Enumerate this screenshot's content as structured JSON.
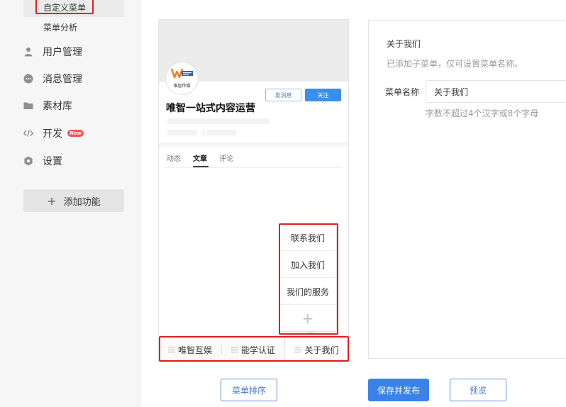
{
  "sidebar": {
    "sub_items": [
      {
        "label": "自定义菜单",
        "active": true
      },
      {
        "label": "菜单分析",
        "active": false
      }
    ],
    "items": [
      {
        "label": "用户管理",
        "icon": "user-icon"
      },
      {
        "label": "消息管理",
        "icon": "message-icon"
      },
      {
        "label": "素材库",
        "icon": "folder-icon"
      },
      {
        "label": "开发",
        "icon": "code-icon",
        "badge": "New"
      },
      {
        "label": "设置",
        "icon": "gear-icon"
      }
    ],
    "add_button": {
      "icon": "plus-icon",
      "label": "添加功能"
    }
  },
  "phone": {
    "avatar_caption": "唯智传媒",
    "account_name": "唯智一站式内容运营",
    "send_message_label": "发消息",
    "follow_label": "关注",
    "tabs": [
      {
        "label": "动态",
        "active": false
      },
      {
        "label": "文章",
        "active": true
      },
      {
        "label": "评论",
        "active": false
      }
    ],
    "submenu": {
      "items": [
        "联系我们",
        "加入我们",
        "我们的服务"
      ],
      "add_icon": "plus-icon"
    },
    "menu": [
      {
        "label": "唯智互娱",
        "active": false
      },
      {
        "label": "能学认证",
        "active": false
      },
      {
        "label": "关于我们",
        "active": true
      }
    ]
  },
  "editor": {
    "title": "关于我们",
    "hint": "已添加子菜单，仅可设置菜单名称。",
    "name_label": "菜单名称",
    "name_value": "关于我们",
    "name_note": "字数不超过4个汉字或8个字母"
  },
  "footer": {
    "sort_label": "菜单排序",
    "save_label": "保存并发布",
    "preview_label": "预览"
  },
  "colors": {
    "highlight": "#e02020",
    "primary": "#3b82e8",
    "sidebar_bg": "#f6f6f6"
  }
}
